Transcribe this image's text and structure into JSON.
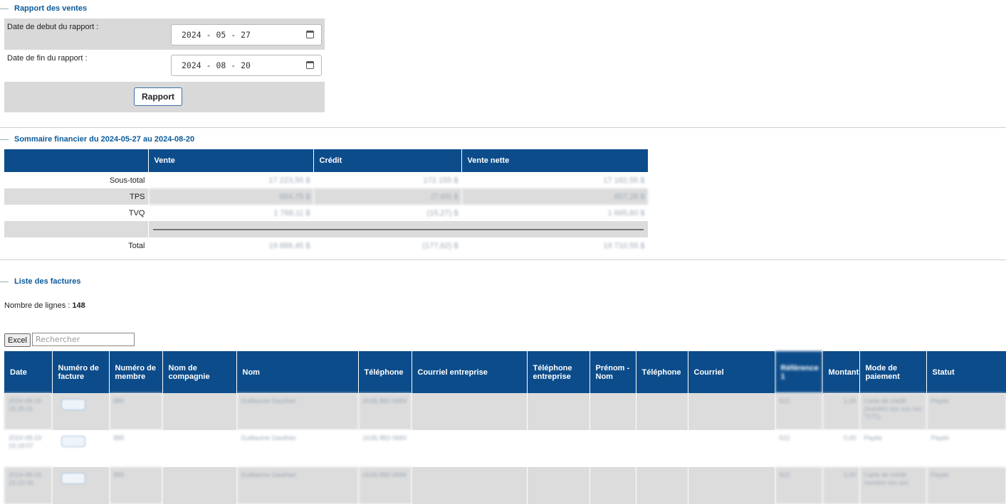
{
  "report_form": {
    "legend": "Rapport des ventes",
    "start_label": "Date de debut du rapport :",
    "start_value": "2024 - 05 - 27",
    "end_label": "Date de fin du rapport :",
    "end_value": "2024 - 08 - 20",
    "submit_label": "Rapport"
  },
  "summary": {
    "legend": "Sommaire financier du 2024-05-27 au 2024-08-20",
    "headers": [
      "",
      "Vente",
      "Crédit",
      "Vente nette"
    ],
    "rows": [
      {
        "label": "Sous-total",
        "vente": "17 223,55 $",
        "credit": "172 155 $",
        "net": "17 182,55 $"
      },
      {
        "label": "TPS",
        "vente": "884,75 $",
        "credit": "(7,65) $",
        "net": "857,28 $"
      },
      {
        "label": "TVQ",
        "vente": "1 768,11 $",
        "credit": "(15,27) $",
        "net": "1 665,60 $"
      },
      {
        "label": "Total",
        "vente": "19 888,45 $",
        "credit": "(177,62) $",
        "net": "19 710,55 $"
      }
    ]
  },
  "invoices": {
    "legend": "Liste des factures",
    "count_label": "Nombre de lignes :",
    "count_value": "148",
    "excel_label": "Excel",
    "search_placeholder": "Rechercher",
    "headers": [
      "Date",
      "Numéro de facture",
      "Numéro de membre",
      "Nom de compagnie",
      "Nom",
      "Téléphone",
      "Courriel entreprise",
      "Téléphone entreprise",
      "Prénom - Nom",
      "Téléphone",
      "Courriel",
      "Référence 1",
      "Montant",
      "Mode de paiement",
      "Statut"
    ],
    "rows": [
      {
        "date": "2024-08-19 15:25:11",
        "facture": "4156",
        "membre": "885",
        "nom": "Guillaume Gauthier",
        "tel": "(418) 882-0684",
        "ref": "622",
        "montant": "1,00",
        "mode": "Carte de crédit (numéro xxx xxx xxx 7171)",
        "statut": "Payée"
      },
      {
        "date": "2024-08-19 16:18:07",
        "facture": "4155",
        "membre": "885",
        "nom": "Guillaume Gauthier",
        "tel": "(418) 882-0684",
        "ref": "622",
        "montant": "0,00",
        "mode": "Payée",
        "statut": "Payée"
      },
      {
        "date": "2024-08-19 15:23:36",
        "facture": "4157",
        "membre": "885",
        "nom": "Guillaume Gauthier",
        "tel": "(418) 882-0684",
        "ref": "622",
        "montant": "0,00",
        "mode": "Carte de crédit numéro xxx xxx",
        "statut": "Payée"
      }
    ]
  }
}
